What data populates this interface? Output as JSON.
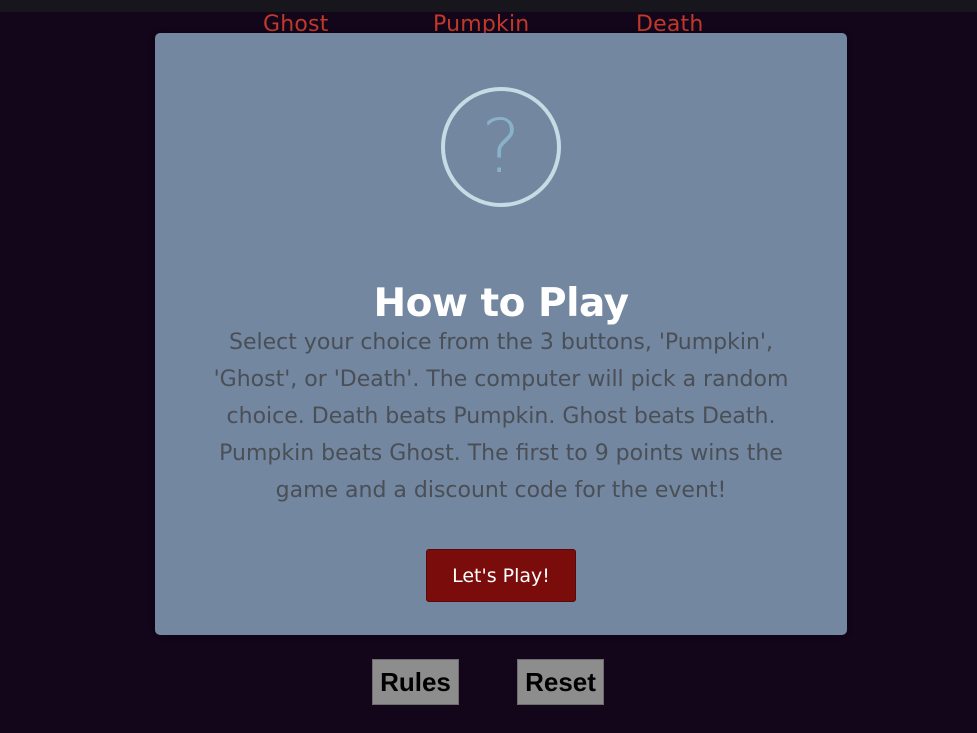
{
  "choices": {
    "ghost": "Ghost",
    "pumpkin": "Pumpkin",
    "death": "Death"
  },
  "modal": {
    "icon": "question-mark-icon",
    "icon_glyph": "?",
    "title": "How to Play",
    "text": "Select your choice from the 3 buttons, 'Pumpkin', 'Ghost', or 'Death'. The computer will pick a random choice. Death beats Pumpkin. Ghost beats Death. Pumpkin beats Ghost. The first to 9 points wins the game and a discount code for the event!",
    "button_label": "Let's Play!"
  },
  "controls": {
    "rules_label": "Rules",
    "reset_label": "Reset"
  },
  "colors": {
    "background": "#13051a",
    "modal_bg": "#7387a0",
    "accent_button": "#7a0c0c",
    "choice_label": "#c0392b"
  }
}
